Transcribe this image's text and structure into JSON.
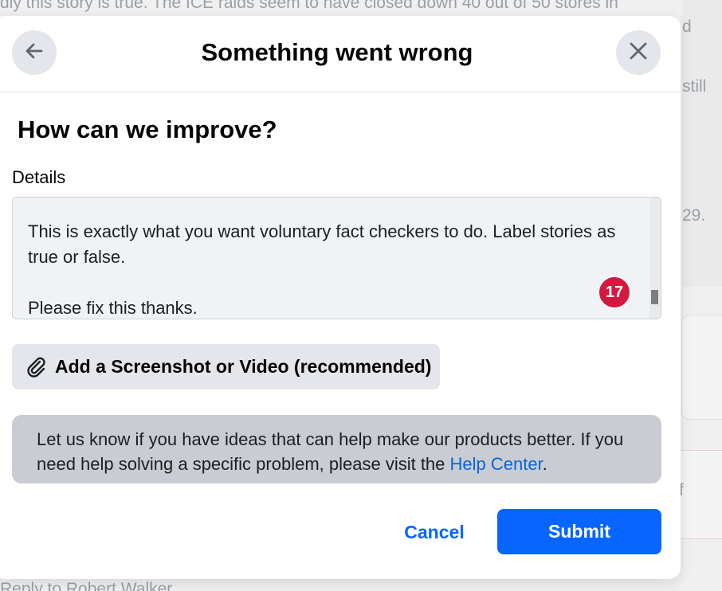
{
  "background": {
    "top_text": "dly this story is true. The ICE raids seem to have closed down 40 out of 50 stores in",
    "right_fragments": [
      "d",
      "still",
      "29.",
      "f"
    ],
    "bottom_text": "Reply to Robert Walker"
  },
  "dialog": {
    "title": "Something went wrong",
    "back_icon": "arrow-left-icon",
    "close_icon": "close-icon",
    "heading": "How can we improve?",
    "details_label": "Details",
    "details_value": "This is exactly what you want voluntary fact checkers to do. Label stories as true or false.\n\nPlease fix this thanks.",
    "badge_count": "17",
    "attach_label": "Add a Screenshot or Video (recommended)",
    "attach_icon": "paperclip-icon",
    "info_text": "Let us know if you have ideas that can help make our products better. If you need help solving a specific problem, please visit the ",
    "help_link": "Help Center",
    "info_suffix": ".",
    "cancel_label": "Cancel",
    "submit_label": "Submit"
  },
  "colors": {
    "primary": "#0866ff",
    "badge": "#d3193f",
    "info_bg": "#c9ccd1"
  }
}
